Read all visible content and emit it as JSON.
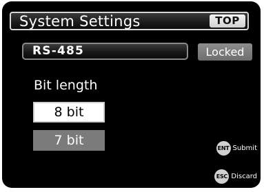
{
  "header": {
    "title": "System Settings",
    "top_button_label": "TOP"
  },
  "parameter": {
    "name": "RS-485",
    "status": "Locked"
  },
  "setting": {
    "label": "Bit length",
    "options": [
      {
        "label": "8 bit",
        "selected": true
      },
      {
        "label": "7 bit",
        "selected": false
      }
    ]
  },
  "footer": {
    "ent_key": "ENT",
    "ent_label": "Submit",
    "esc_key": "ESC",
    "esc_label": "Discard"
  },
  "colors": {
    "background": "#000000",
    "selected_option": "#ffffff",
    "unselected_option": "#7b7b7b",
    "locked_badge": "#7d7d7d"
  }
}
